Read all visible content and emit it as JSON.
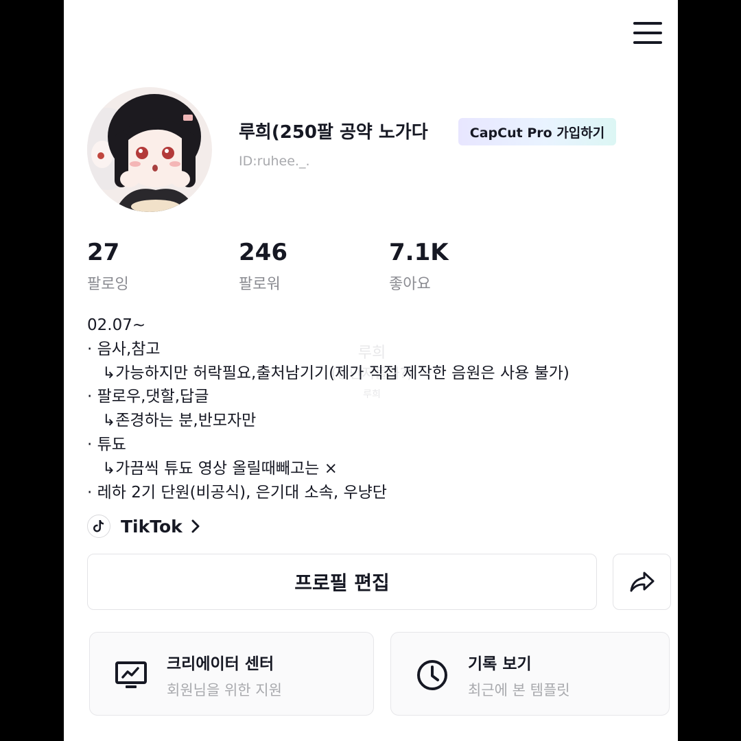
{
  "profile": {
    "name": "루희(250팔 공약 노가다",
    "id_text": "ID:ruhee._.",
    "capcut_badge": "CapCut Pro 가입하기"
  },
  "stats": [
    {
      "value": "27",
      "label": "팔로잉"
    },
    {
      "value": "246",
      "label": "팔로워"
    },
    {
      "value": "7.1K",
      "label": "좋아요"
    }
  ],
  "bio": [
    "02.07~",
    "· 음사,참고",
    "  ↳가능하지만 허락필요,출처남기기(제가 직접 제작한 음원은 사용 불가)",
    "· 팔로우,댓할,답글",
    "  ↳존경하는 분,반모자만",
    "· 튜됴",
    "  ↳가끔씩 튜됴 영상 올릴때빼고는 ×",
    "· 레하 2기 단원(비공식), 은기대 소속, 우냥단"
  ],
  "watermark": {
    "line1": "루희",
    "line2": "(상단저돌까?)",
    "line3": "루희"
  },
  "tiktok_link": {
    "label": "TikTok",
    "icon": "tiktok-logo-icon"
  },
  "actions": {
    "edit_profile": "프로필 편집",
    "share_icon": "share-arrow-icon",
    "menu_icon": "hamburger-menu-icon"
  },
  "cards": [
    {
      "title": "크리에이터 센터",
      "subtitle": "회원님을 위한 지원",
      "icon": "monitor-chart-icon"
    },
    {
      "title": "기록 보기",
      "subtitle": "최근에 본 템플릿",
      "icon": "clock-icon"
    }
  ],
  "colors": {
    "text_primary": "#161823",
    "text_secondary": "#8a8b91",
    "text_muted": "#a8a9ad",
    "border": "#e3e3e6",
    "side_bars": "#000000"
  }
}
